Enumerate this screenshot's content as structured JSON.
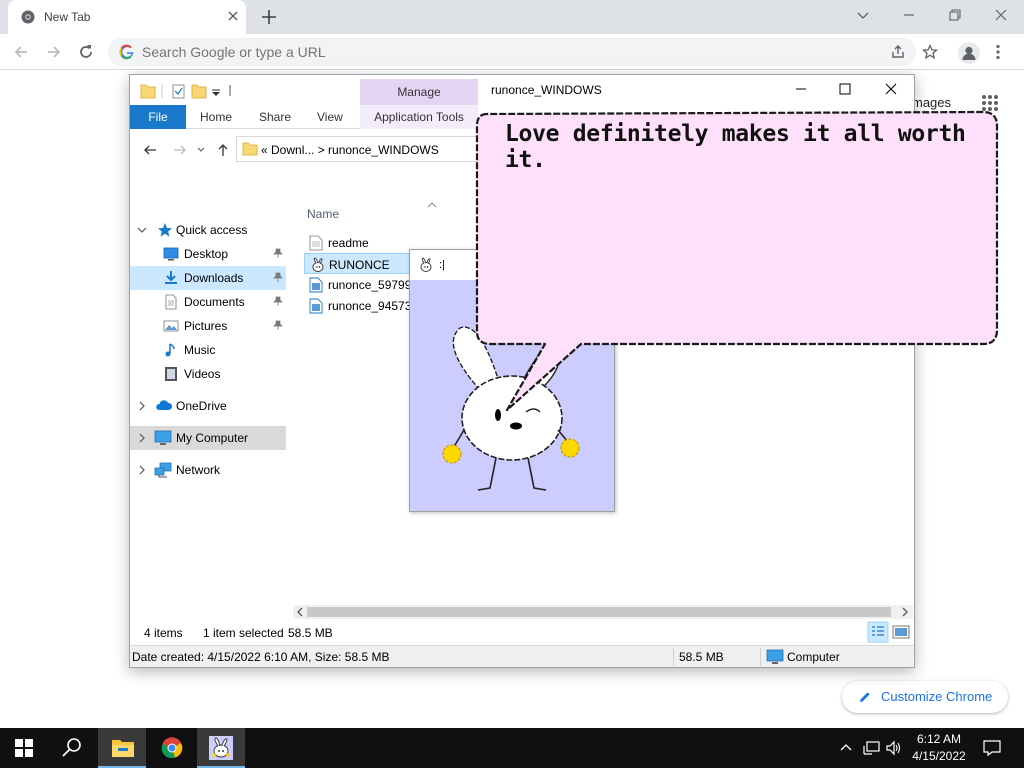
{
  "browser": {
    "tab_title": "New Tab",
    "omnibox_placeholder": "Search Google or type a URL",
    "ntp_images_link": "mages",
    "customize_label": "Customize Chrome"
  },
  "explorer": {
    "window_title": "runonce_WINDOWS",
    "manage_label": "Manage",
    "ribbon_tabs": [
      "File",
      "Home",
      "Share",
      "View",
      "Application Tools"
    ],
    "address_crumbs": "« Downl...  >  runonce_WINDOWS",
    "nav_items": {
      "quick_access": "Quick access",
      "desktop": "Desktop",
      "downloads": "Downloads",
      "documents": "Documents",
      "pictures": "Pictures",
      "music": "Music",
      "videos": "Videos",
      "onedrive": "OneDrive",
      "my_computer": "My Computer",
      "network": "Network"
    },
    "column_name": "Name",
    "files": [
      "readme",
      "RUNONCE",
      "runonce_59799...",
      "runonce_94573..."
    ],
    "status": {
      "items": "4 items",
      "selected": "1 item selected",
      "size": "58.5 MB"
    },
    "details": {
      "info": "Date created: 4/15/2022 6:10 AM, Size: 58.5 MB",
      "size": "58.5 MB",
      "location": "Computer"
    }
  },
  "runonce_window": {
    "title": ":|"
  },
  "speech_bubble": {
    "text": "Love definitely makes it all worth it."
  },
  "taskbar": {
    "time": "6:12 AM",
    "date": "4/15/2022"
  },
  "colors": {
    "accent_blue": "#1979ca",
    "manage_purple": "#e6d4f5",
    "bubble_pink": "#ffe0fa",
    "runonce_bg": "#ccccff",
    "taskbar": "#101010"
  }
}
